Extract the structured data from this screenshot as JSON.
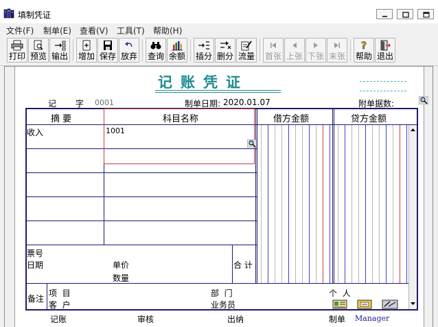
{
  "window": {
    "title": "填制凭证"
  },
  "menu": [
    {
      "label": "文件(F)"
    },
    {
      "label": "制单(E)"
    },
    {
      "label": "查看(V)"
    },
    {
      "label": "工具(T)"
    },
    {
      "label": "帮助(H)"
    }
  ],
  "toolbar": {
    "print": "打印",
    "preview": "预览",
    "export": "输出",
    "add": "增加",
    "save": "保存",
    "discard": "放弃",
    "query": "查询",
    "balance": "余额",
    "insert_row": "插分",
    "delete_row": "删分",
    "flow": "流量",
    "first": "首张",
    "prev": "上张",
    "next": "下张",
    "last": "末张",
    "help": "帮助",
    "exit": "退出"
  },
  "voucher": {
    "title": "记账凭证",
    "type_char": "记",
    "word_label": "字",
    "number": "0001",
    "date_label": "制单日期:",
    "date": "2020.01.07",
    "attach_label": "附单据数:"
  },
  "table": {
    "headers": {
      "summary": "摘 要",
      "account": "科目名称",
      "debit": "借方金额",
      "credit": "贷方金额"
    },
    "rows": [
      {
        "summary": "收入",
        "account": "1001"
      }
    ],
    "ticket_no_label": "票号",
    "date_label": "日期",
    "unit_price_label": "单价",
    "quantity_label": "数量",
    "total_label": "合 计"
  },
  "remarks": {
    "label": "备注",
    "project_label": "项  目",
    "customer_label": "客  户",
    "department_label": "部  门",
    "salesman_label": "业务员",
    "personal_label": "个  人"
  },
  "footer": {
    "bookkeeping": "记账",
    "audit": "审核",
    "cashier": "出纳",
    "maker_label": "制单",
    "maker": "Manager"
  },
  "colors": {
    "grid": "#1d1a6e",
    "title": "#1e8a8c",
    "debit_lines": "#4040d0",
    "credit_lines": "#c83c3c",
    "selection": "#c83c3c"
  }
}
